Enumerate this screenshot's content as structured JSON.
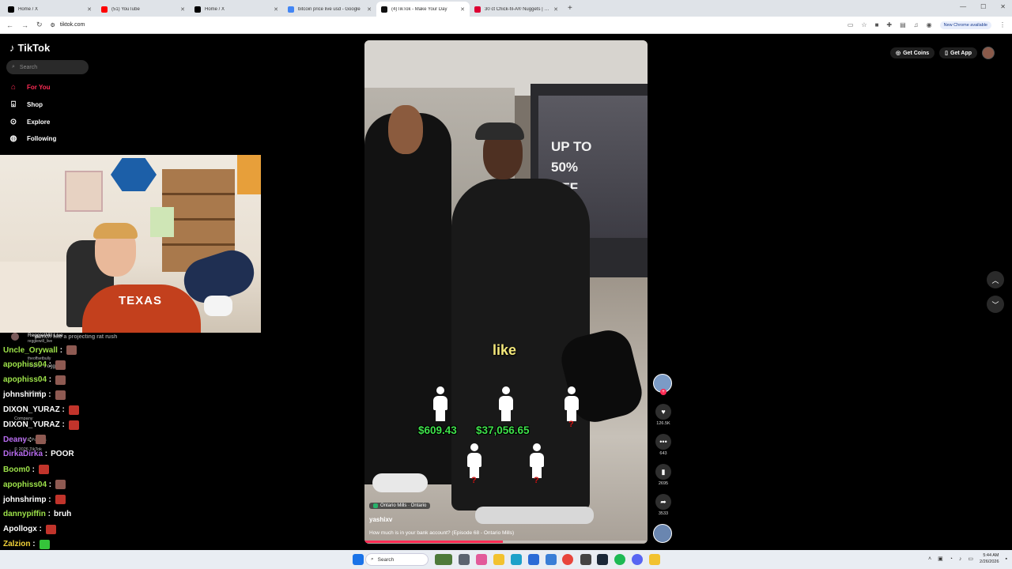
{
  "browser": {
    "tabs": [
      {
        "title": "Home / X",
        "favicon_color": "#000000",
        "active": false
      },
      {
        "title": "(51) YouTube",
        "favicon_color": "#ff0000",
        "active": false
      },
      {
        "title": "Home / X",
        "favicon_color": "#000000",
        "active": false
      },
      {
        "title": "bitcoin price live usd - Google",
        "favicon_color": "#4285f4",
        "active": false
      },
      {
        "title": "(4)TikTok - Make Your Day",
        "favicon_color": "#111111",
        "active": true
      },
      {
        "title": "30 ct Chick-fil-A® Nuggets | Ch",
        "favicon_color": "#dd0033",
        "active": false
      }
    ],
    "url": "tiktok.com",
    "new_chrome_label": "New Chrome available"
  },
  "tiktok": {
    "logo_text": "TikTok",
    "search_placeholder": "Search",
    "nav": [
      {
        "label": "For You",
        "icon": "home-icon",
        "active": true
      },
      {
        "label": "Shop",
        "icon": "shopping-bag-icon",
        "active": false
      },
      {
        "label": "Explore",
        "icon": "compass-icon",
        "active": false
      },
      {
        "label": "Following",
        "icon": "following-icon",
        "active": false
      }
    ],
    "get_coins": "Get Coins",
    "get_app": "Get App",
    "sidebar_ghost": [
      "Company",
      "Terms & Policies",
      "© 2026 TikTok"
    ]
  },
  "webcam": {
    "shirt_text": "TEXAS"
  },
  "chat": {
    "header_name": "ReggieWill Live",
    "header_handle": "reggiewill_live",
    "header_overlap_text": "punch like a projecting rat rush",
    "ghost_lines": [
      "theoffsetbully",
      "Walton Goggins",
      "View all"
    ],
    "messages": [
      {
        "user": "Uncle_Orywall",
        "color": "#9ee34a",
        "text": "",
        "emote_color": "#8e5a52"
      },
      {
        "user": "apophiss04",
        "color": "#9ee34a",
        "text": "",
        "emote_color": "#8e5a52"
      },
      {
        "user": "apophiss04",
        "color": "#9ee34a",
        "text": "",
        "emote_color": "#8e5a52"
      },
      {
        "user": "johnshrimp",
        "color": "#ffffff",
        "text": "",
        "emote_color": "#8e5a52"
      },
      {
        "user": "DIXON_YURAZ",
        "color": "#ffffff",
        "text": "",
        "emote_color": "#c1342b"
      },
      {
        "user": "DIXON_YURAZ",
        "color": "#ffffff",
        "text": "",
        "emote_color": "#c1342b"
      },
      {
        "user": "Deany",
        "color": "#b86cf0",
        "text": "",
        "emote_color": "#8e5a52"
      },
      {
        "user": "DirkaDirka",
        "color": "#b86cf0",
        "text": "POOR",
        "emote_color": ""
      },
      {
        "user": "Boom0",
        "color": "#9ee34a",
        "text": "",
        "emote_color": "#c1342b"
      },
      {
        "user": "apophiss04",
        "color": "#9ee34a",
        "text": "",
        "emote_color": "#8e5a52"
      },
      {
        "user": "johnshrimp",
        "color": "#ffffff",
        "text": "",
        "emote_color": "#c1342b"
      },
      {
        "user": "dannypiffin",
        "color": "#9ee34a",
        "text": "bruh",
        "emote_color": ""
      },
      {
        "user": "Apollogx",
        "color": "#ffffff",
        "text": "",
        "emote_color": "#c1342b"
      },
      {
        "user": "Zalzion",
        "color": "#f2d33a",
        "text": "",
        "emote_color": "#35c43a"
      },
      {
        "user": "Apollogx",
        "color": "#ffffff",
        "text": "",
        "emote_color": "#c1342b"
      }
    ]
  },
  "video": {
    "store_sign": "UP TO 50% OFF",
    "caption_word": "like",
    "amounts": [
      "$609.43",
      "$37,056.65"
    ],
    "question_mark": "?",
    "location": "Ontario Mills · Ontario",
    "author": "yashixv",
    "description": "How much is in your bank account? (Episode 68 - Ontario Mills)",
    "progress_fraction": 0.49
  },
  "actions": {
    "likes": "126.5K",
    "comments": "643",
    "saves": "2695",
    "shares": "3533"
  },
  "taskbar": {
    "search_placeholder": "Search",
    "time": "5:44 AM",
    "date": "2/26/2026"
  }
}
